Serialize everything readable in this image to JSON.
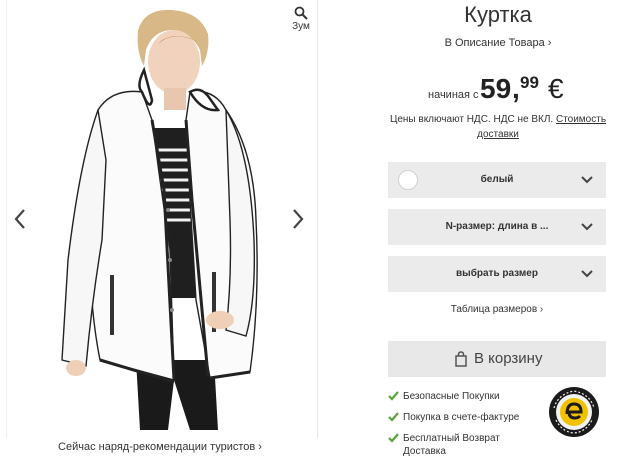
{
  "gallery": {
    "zoom_label": "Зум",
    "recommendation_link": "Сейчас наряд-рекомендации туристов ›"
  },
  "product": {
    "title": "Куртка",
    "description_link": "В Описание Товара ›",
    "price_prefix": "начиная с",
    "price_integer": "59",
    "price_decimal": "99",
    "currency": "€",
    "vat_text": "Цены включают НДС. НДС не ВКЛ.",
    "shipping_link": "Стоимость доставки"
  },
  "selects": {
    "color": "белый",
    "length": "N-размер: длина в ...",
    "size": "выбрать размер"
  },
  "size_table_link": "Таблица размеров ›",
  "cart_button": "В корзину",
  "usps": [
    "Безопасные Покупки",
    "Покупка в счете-фактуре",
    "Бесплатный Возврат Доставка"
  ],
  "colors": {
    "check_green": "#5aa33a",
    "button_gray": "#e8e8e8",
    "select_gray": "#ebebeb"
  },
  "icons": {
    "zoom": "magnifier-icon",
    "prev": "chevron-left-icon",
    "next": "chevron-right-icon",
    "select": "chevron-down-icon",
    "cart": "shopping-bag-icon",
    "check": "check-icon",
    "badge": "trusted-shops-badge"
  }
}
